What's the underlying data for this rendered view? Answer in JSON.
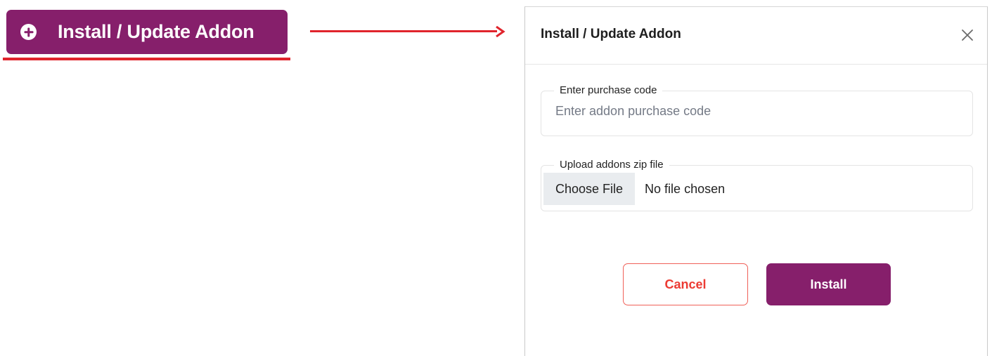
{
  "trigger": {
    "label": "Install / Update Addon",
    "icon": "plus-circle-icon"
  },
  "modal": {
    "title": "Install / Update Addon",
    "close_icon": "close-icon",
    "purchase_code": {
      "legend": "Enter purchase code",
      "placeholder": "Enter addon purchase code",
      "value": ""
    },
    "zip_upload": {
      "legend": "Upload addons zip file",
      "button_label": "Choose File",
      "status": "No file chosen"
    },
    "cancel_label": "Cancel",
    "install_label": "Install"
  },
  "colors": {
    "brand": "#861f6b",
    "annotation_red": "#e0242c",
    "cancel_red": "#ec3b33"
  }
}
